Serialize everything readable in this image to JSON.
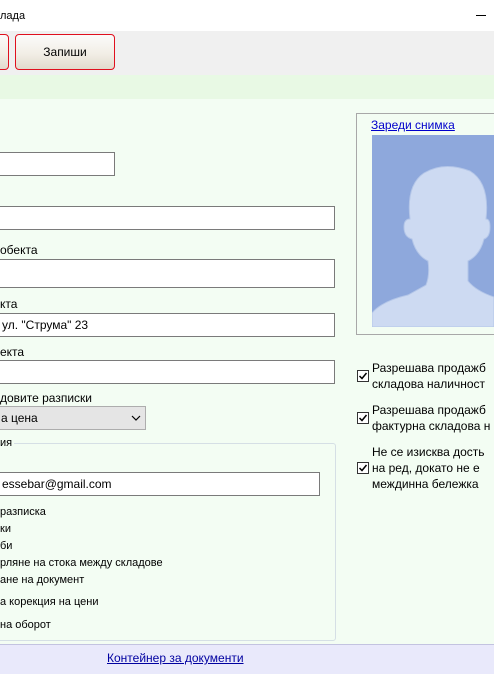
{
  "window": {
    "title": "лада"
  },
  "toolbar": {
    "save_label": "Запиши"
  },
  "form": {
    "object_label": "обекта",
    "address_label": "кта",
    "address_value": "ул. \"Струма\" 23",
    "label_4": "екта",
    "receipts_label": "довите разписки",
    "price_select_value": "а цена",
    "group_title": "ия",
    "email_value": "essebar@gmail.com",
    "options": [
      "разписка",
      "ки",
      "би",
      "рляне на стока между складове",
      "ане на документ",
      "а корекция на цени",
      "на оборот"
    ]
  },
  "photo": {
    "load_link": "Зареди снимка"
  },
  "checkboxes": [
    {
      "lines": [
        "Разрешава продажб",
        "складова наличност"
      ],
      "checked": true
    },
    {
      "lines": [
        "Разрешава продажб",
        "фактурна складова н"
      ],
      "checked": true
    },
    {
      "lines": [
        "Не се изисква дость",
        "на ред, докато не е",
        "междинна бележка"
      ],
      "checked": true
    }
  ],
  "footer": {
    "documents_link": "Контейнер за документи"
  }
}
